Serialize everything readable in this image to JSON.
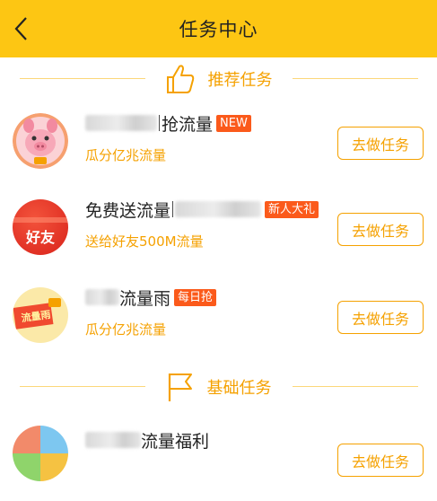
{
  "header": {
    "title": "任务中心",
    "back_icon": "chevron-left-icon"
  },
  "sections": [
    {
      "label": "推荐任务",
      "icon": "thumbs-up-icon"
    },
    {
      "label": "基础任务",
      "icon": "flag-icon"
    }
  ],
  "tasks": [
    {
      "name": "抢流量",
      "badge": "NEW",
      "subtitle": "瓜分亿兆流量",
      "button": "去做任务",
      "avatar": "pig-mascot"
    },
    {
      "name": "免费送流量",
      "badge": "新人大礼",
      "subtitle": "送给好友500M流量",
      "button": "去做任务",
      "avatar_text": "好友"
    },
    {
      "name": "流量雨",
      "badge": "每日抢",
      "subtitle": "瓜分亿兆流量",
      "button": "去做任务",
      "avatar_text": "流量雨"
    },
    {
      "name": "流量福利",
      "button": "去做任务",
      "avatar": "colorful-tiles"
    }
  ],
  "colors": {
    "header_bg": "#fdc613",
    "accent": "#f5a100",
    "badge_bg": "#fb5a1b"
  }
}
